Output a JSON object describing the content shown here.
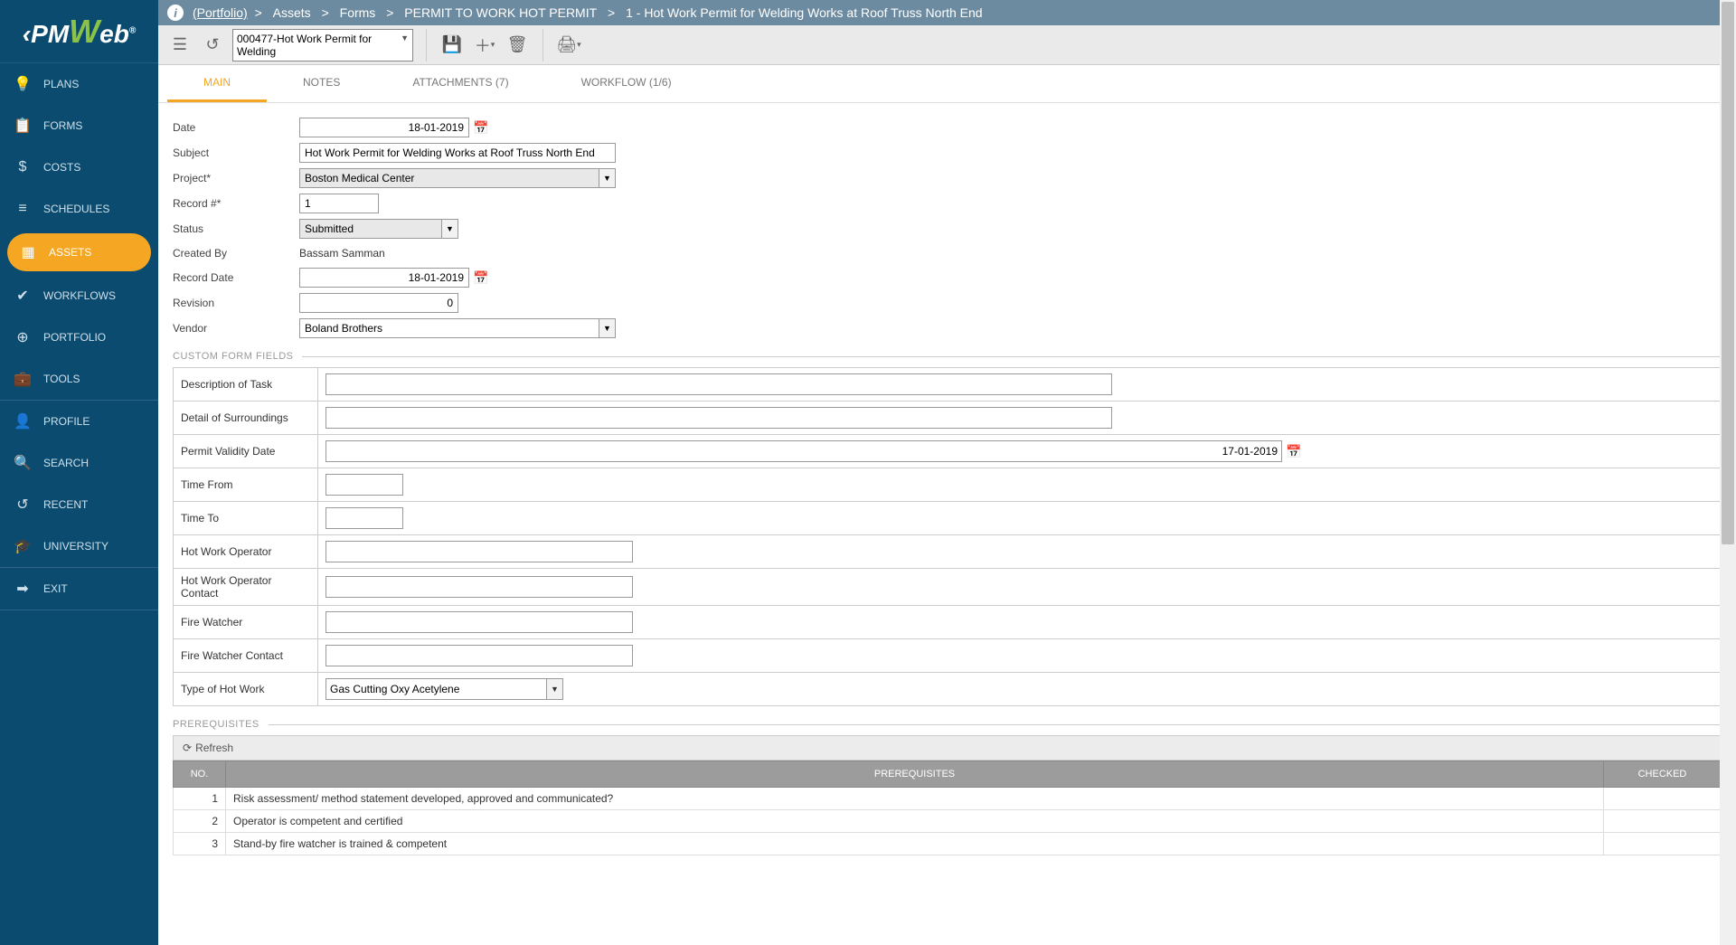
{
  "logo": {
    "prefix": "‹PM",
    "mid": "W",
    "suffix": "eb",
    "reg": "®"
  },
  "sidebar": {
    "main": [
      {
        "icon": "💡",
        "label": "PLANS"
      },
      {
        "icon": "📋",
        "label": "FORMS"
      },
      {
        "icon": "$",
        "label": "COSTS"
      },
      {
        "icon": "≡",
        "label": "SCHEDULES"
      },
      {
        "icon": "▦",
        "label": "ASSETS",
        "active": true
      },
      {
        "icon": "✔",
        "label": "WORKFLOWS"
      },
      {
        "icon": "⊕",
        "label": "PORTFOLIO"
      },
      {
        "icon": "💼",
        "label": "TOOLS"
      }
    ],
    "secondary": [
      {
        "icon": "👤",
        "label": "PROFILE"
      },
      {
        "icon": "🔍",
        "label": "SEARCH"
      },
      {
        "icon": "↺",
        "label": "RECENT"
      },
      {
        "icon": "🎓",
        "label": "UNIVERSITY"
      }
    ],
    "exit": {
      "icon": "➡",
      "label": "EXIT"
    }
  },
  "breadcrumb": {
    "portfolio": "(Portfolio)",
    "sep": ">",
    "parts": [
      "Assets",
      "Forms",
      "PERMIT TO WORK HOT PERMIT",
      "1 - Hot Work Permit for Welding Works at Roof Truss North End"
    ]
  },
  "toolbar": {
    "record": "000477-Hot Work Permit for Welding"
  },
  "tabs": [
    {
      "label": "MAIN",
      "active": true
    },
    {
      "label": "NOTES"
    },
    {
      "label": "ATTACHMENTS (7)"
    },
    {
      "label": "WORKFLOW (1/6)"
    }
  ],
  "form": {
    "date_label": "Date",
    "date_value": "18-01-2019",
    "subject_label": "Subject",
    "subject_value": "Hot Work Permit for Welding Works at Roof Truss North End",
    "project_label": "Project*",
    "project_value": "Boston Medical Center",
    "record_label": "Record #*",
    "record_value": "1",
    "status_label": "Status",
    "status_value": "Submitted",
    "createdby_label": "Created By",
    "createdby_value": "Bassam Samman",
    "recorddate_label": "Record Date",
    "recorddate_value": "18-01-2019",
    "revision_label": "Revision",
    "revision_value": "0",
    "vendor_label": "Vendor",
    "vendor_value": "Boland Brothers"
  },
  "sections": {
    "custom": "CUSTOM FORM FIELDS",
    "prereq": "PREREQUISITES"
  },
  "custom_fields": {
    "desc": "Description of Task",
    "detail": "Detail of Surroundings",
    "validity": "Permit Validity Date",
    "validity_value": "17-01-2019",
    "timefrom": "Time From",
    "timeto": "Time To",
    "operator": "Hot Work Operator",
    "operator_contact": "Hot Work Operator Contact",
    "watcher": "Fire Watcher",
    "watcher_contact": "Fire Watcher Contact",
    "type": "Type of Hot Work",
    "type_value": "Gas Cutting Oxy Acetylene"
  },
  "prereq": {
    "refresh": "Refresh",
    "headers": {
      "no": "NO.",
      "text": "PREREQUISITES",
      "checked": "CHECKED"
    },
    "rows": [
      {
        "no": "1",
        "text": "Risk assessment/ method statement developed, approved and communicated?"
      },
      {
        "no": "2",
        "text": "Operator is competent and certified"
      },
      {
        "no": "3",
        "text": "Stand-by fire watcher is trained & competent"
      }
    ]
  }
}
